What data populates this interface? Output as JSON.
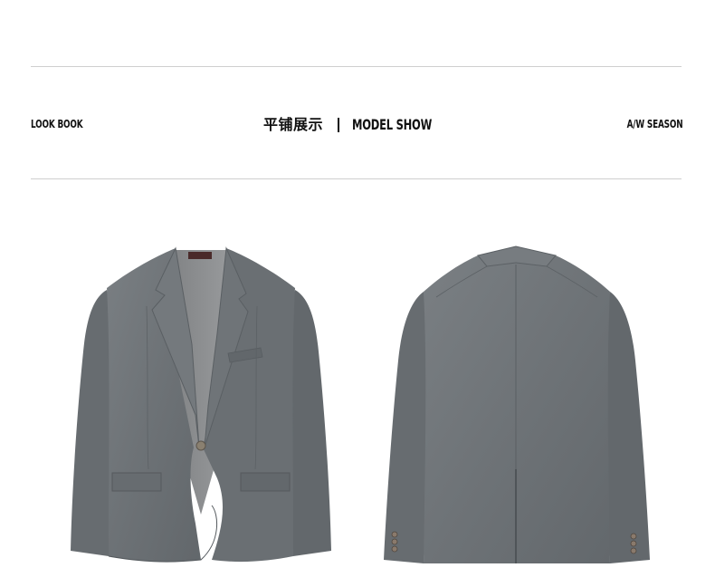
{
  "header": {
    "left_label": "LOOK BOOK",
    "title_cn": "平铺展示",
    "title_en": "MODEL SHOW",
    "right_label": "A/W SEASON"
  },
  "images": {
    "front": "grey-suit-jacket-front",
    "back": "grey-suit-jacket-back"
  },
  "colors": {
    "fabric": "#6f7478",
    "fabric_dark": "#5c6165",
    "fabric_light": "#868b8f",
    "lining": "#8a8c8e",
    "button": "#7a6a5e",
    "rule": "#cfcfcf"
  }
}
